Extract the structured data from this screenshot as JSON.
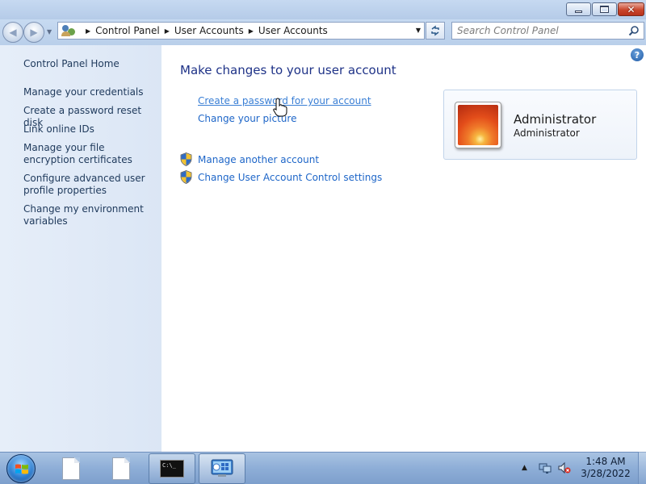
{
  "window": {
    "minimize_label": "",
    "maximize_label": "",
    "close_label": "✕"
  },
  "address_bar": {
    "breadcrumbs": [
      "Control Panel",
      "User Accounts",
      "User Accounts"
    ]
  },
  "search": {
    "placeholder": "Search Control Panel"
  },
  "sidebar": {
    "home": "Control Panel Home",
    "items": [
      {
        "label": "Manage your credentials"
      },
      {
        "label": "Create a password reset disk"
      },
      {
        "label": "Link online IDs"
      },
      {
        "label": "Manage your file encryption certificates"
      },
      {
        "label": "Configure advanced user profile properties"
      },
      {
        "label": "Change my environment variables"
      }
    ]
  },
  "main": {
    "title": "Make changes to your user account",
    "links": {
      "create_password": "Create a password for your account",
      "change_picture": "Change your picture",
      "manage_another": "Manage another account",
      "uac_settings": "Change User Account Control settings"
    },
    "account": {
      "name": "Administrator",
      "type": "Administrator"
    }
  },
  "taskbar": {
    "cmd_icon_text": "C:\\_",
    "clock": {
      "time": "1:48 AM",
      "date": "3/28/2022"
    }
  },
  "colors": {
    "link": "#1e66c8",
    "title": "#1e3287",
    "sidebar_bg": "#dbe6f5"
  },
  "icons": [
    "back-icon",
    "forward-icon",
    "user-accounts-icon",
    "refresh-icon",
    "search-icon",
    "help-icon",
    "shield-icon",
    "hand-cursor-icon",
    "start-orb-icon",
    "file-icon",
    "cmd-icon",
    "control-panel-icon",
    "network-icon",
    "volume-muted-icon"
  ]
}
